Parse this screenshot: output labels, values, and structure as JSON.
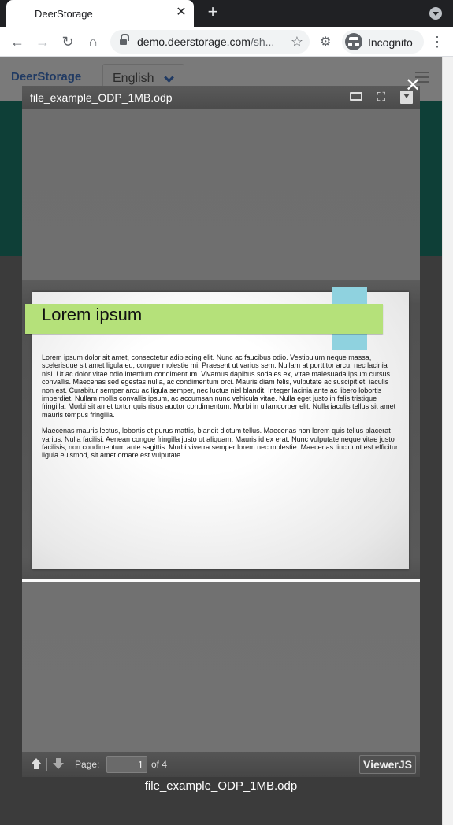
{
  "browser": {
    "tab_title": "DeerStorage",
    "tab_close_glyph": "✕",
    "new_tab_glyph": "+",
    "url_host": "demo.deerstorage.com",
    "url_rest": "/sh...",
    "incognito_label": "Incognito",
    "icons": [
      "back-icon",
      "forward-icon",
      "reload-icon",
      "home-icon",
      "lock-icon",
      "star-icon",
      "extensions-icon",
      "incognito-icon",
      "menu-icon"
    ]
  },
  "site": {
    "brand": "DeerStorage",
    "language": "English"
  },
  "viewer": {
    "file_title": "file_example_ODP_1MB.odp",
    "close_glyph": "✕",
    "slide": {
      "title": "Lorem ipsum",
      "paragraph1": "Lorem ipsum dolor sit amet, consectetur adipiscing elit. Nunc ac faucibus odio. Vestibulum neque massa, scelerisque sit amet ligula eu, congue molestie mi. Praesent ut varius sem. Nullam at porttitor arcu, nec lacinia nisi. Ut ac dolor vitae odio interdum condimentum. Vivamus dapibus sodales ex, vitae malesuada ipsum cursus convallis. Maecenas sed egestas nulla, ac condimentum orci. Mauris diam felis, vulputate ac suscipit et, iaculis non est. Curabitur semper arcu ac ligula semper, nec luctus nisl blandit. Integer lacinia ante ac libero lobortis imperdiet. Nullam mollis convallis ipsum, ac accumsan nunc vehicula vitae. Nulla eget justo in felis tristique fringilla. Morbi sit amet tortor quis risus auctor condimentum. Morbi in ullamcorper elit. Nulla iaculis tellus sit amet mauris tempus fringilla.",
      "paragraph2": "Maecenas mauris lectus, lobortis et purus mattis, blandit dictum tellus. Maecenas non lorem quis tellus placerat varius. Nulla facilisi. Aenean congue fringilla justo ut aliquam. Mauris id ex erat. Nunc vulputate neque vitae justo facilisis, non condimentum ante sagittis. Morbi viverra semper lorem nec molestie. Maecenas tincidunt est efficitur ligula euismod, sit amet ornare est vulputate."
    },
    "footer": {
      "page_label": "Page:",
      "page_value": "1",
      "page_of": "of 4",
      "brand_button": "ViewerJS"
    },
    "caption": "file_example_ODP_1MB.odp"
  }
}
